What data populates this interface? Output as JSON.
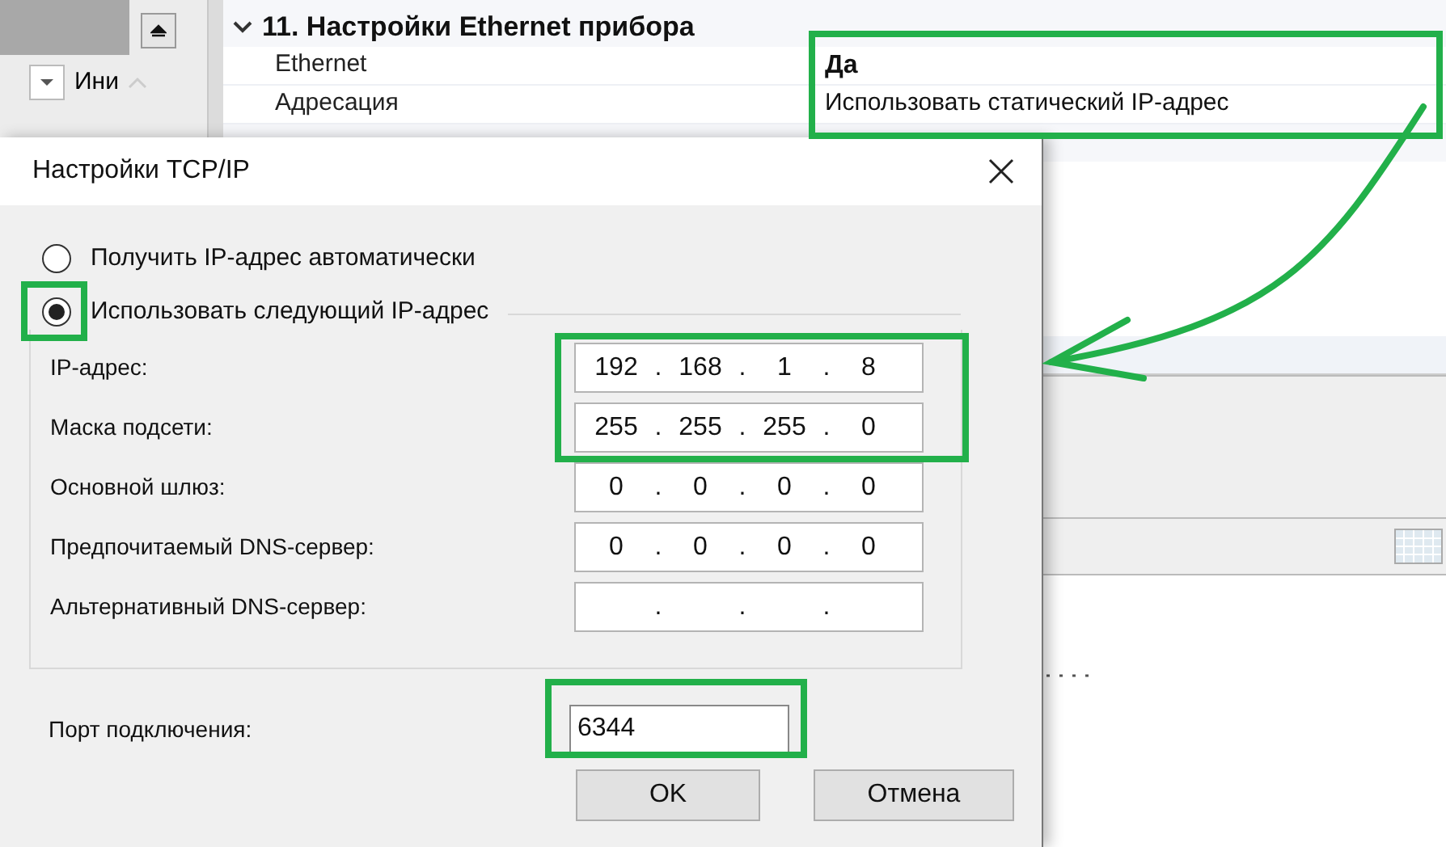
{
  "background": {
    "partial_label": "Ини",
    "section": {
      "title": "11. Настройки Ethernet прибора",
      "rows": [
        {
          "label": "Ethernet",
          "value": "Да",
          "bold": true
        },
        {
          "label": "Адресация",
          "value": "Использовать статический IP-адрес",
          "bold": false
        }
      ]
    }
  },
  "dialog": {
    "title": "Настройки TCP/IP",
    "radios": [
      {
        "label": "Получить IP-адрес автоматически",
        "selected": false
      },
      {
        "label": "Использовать следующий IP-адрес",
        "selected": true
      }
    ],
    "fields": [
      {
        "label": "IP-адрес:",
        "kind": "address",
        "octets": [
          "192",
          "168",
          "1",
          "8"
        ]
      },
      {
        "label": "Маска подсети:",
        "kind": "address",
        "octets": [
          "255",
          "255",
          "255",
          "0"
        ]
      },
      {
        "label": "Основной шлюз:",
        "kind": "address",
        "octets": [
          "0",
          "0",
          "0",
          "0"
        ]
      },
      {
        "label": "Предпочитаемый DNS-сервер:",
        "kind": "address",
        "octets": [
          "0",
          "0",
          "0",
          "0"
        ]
      },
      {
        "label": "Альтернативный DNS-сервер:",
        "kind": "empty"
      }
    ],
    "separator": ".",
    "port": {
      "label": "Порт подключения:",
      "value": "6344"
    },
    "buttons": [
      "OK",
      "Отмена"
    ]
  }
}
